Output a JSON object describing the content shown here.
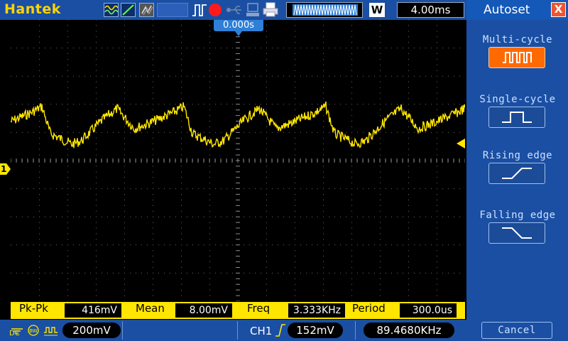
{
  "app": {
    "brand": "Hantek"
  },
  "topbar": {
    "timebase": "4.00ms",
    "acq_mode_label": "W",
    "icons": [
      "waveform-icon",
      "ramp-icon",
      "persistence-icon",
      "pulse-trigger-icon",
      "record-icon",
      "usb-icon",
      "network-icon",
      "printer-icon"
    ],
    "record_color": "#ff1a1a"
  },
  "screen": {
    "time_offset": "0.000s",
    "trace_color": "#ffe600",
    "channel_marker": "1"
  },
  "measurements": [
    {
      "label": "Pk-Pk",
      "value": "416mV"
    },
    {
      "label": "Mean",
      "value": "8.00mV"
    },
    {
      "label": "Freq",
      "value": "3.333KHz"
    },
    {
      "label": "Period",
      "value": "300.0us"
    }
  ],
  "bottombar": {
    "coupling": "DC",
    "ch1_scale": "200mV",
    "trigger_source": "CH1",
    "trigger_level": "152mV",
    "trigger_freq": "89.4680KHz"
  },
  "panel": {
    "title": "Autoset",
    "close_label": "X",
    "options": [
      {
        "label": "Multi-cycle",
        "icon": "multi-cycle-icon",
        "active": true
      },
      {
        "label": "Single-cycle",
        "icon": "single-cycle-icon",
        "active": false
      },
      {
        "label": "Rising edge",
        "icon": "rising-edge-icon",
        "active": false
      },
      {
        "label": "Falling edge",
        "icon": "falling-edge-icon",
        "active": false
      }
    ],
    "cancel_label": "Cancel"
  }
}
